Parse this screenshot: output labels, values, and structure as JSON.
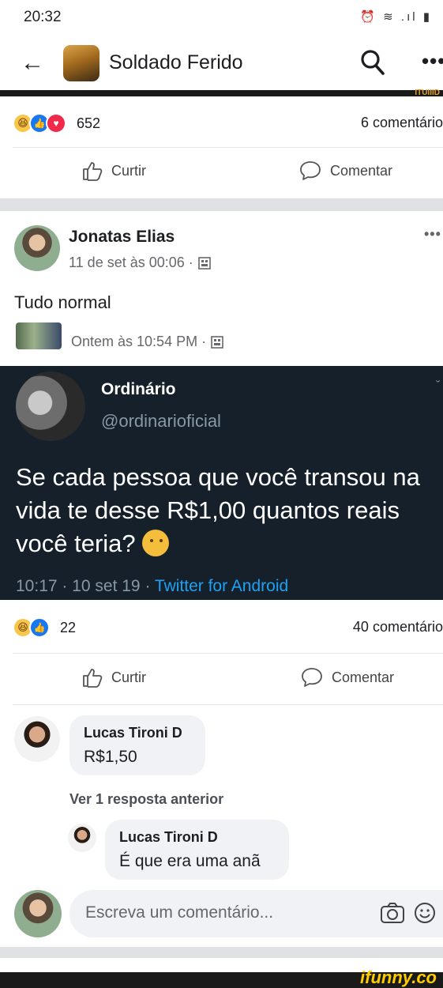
{
  "status_bar": {
    "time": "20:32",
    "icons": "⏰ ≋ .ıl ▮"
  },
  "app_bar": {
    "title": "Soldado Ferido",
    "partial_banner_text": "ITUIIID"
  },
  "top_post": {
    "reactions": [
      "haha",
      "like",
      "love"
    ],
    "reaction_count": "652",
    "comment_count": "6 comentário",
    "like_label": "Curtir",
    "comment_label": "Comentar"
  },
  "post": {
    "author": "Jonatas Elias",
    "timestamp": "11 de set às 00:06 ·",
    "text": "Tudo normal",
    "shared_timestamp": "Ontem às 10:54 PM ·",
    "tweet": {
      "name": "Ordinário",
      "handle": "@ordinarioficial",
      "text": "Se cada pessoa que você transou na vida te desse R$1,00 quantos reais você teria?",
      "time": "10:17 · 10 set 19 ·",
      "source": "Twitter for Android"
    },
    "reactions": [
      "haha",
      "like"
    ],
    "reaction_count": "22",
    "comment_count": "40 comentário",
    "like_label": "Curtir",
    "comment_label": "Comentar"
  },
  "comments": [
    {
      "name": "Lucas Tironi D",
      "text": "R$1,50"
    },
    {
      "name": "Lucas Tironi D",
      "text": "É que era uma anã"
    }
  ],
  "view_previous": "Ver 1 resposta anterior",
  "composer": {
    "placeholder": "Escreva um comentário..."
  },
  "watermark": "ifunny.co",
  "colors": {
    "like_blue": "#1877f2",
    "twitter_bg": "#15202b",
    "twitter_link": "#1da1f2"
  }
}
